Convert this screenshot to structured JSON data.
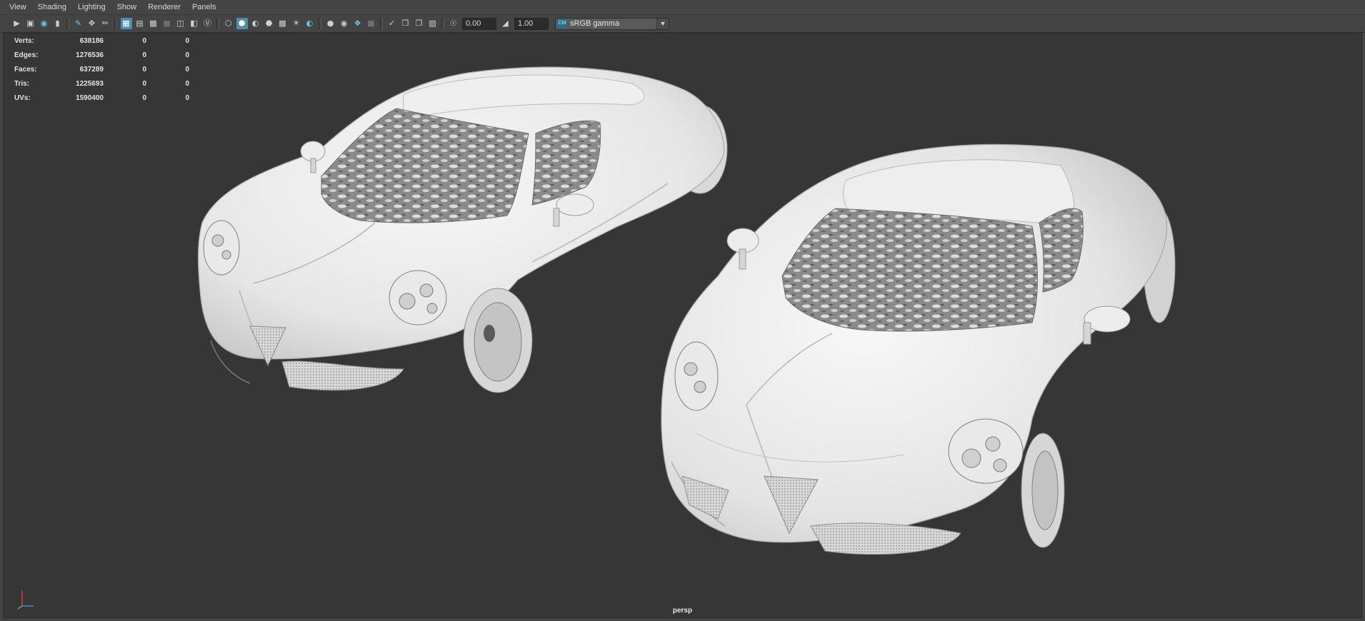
{
  "menu": {
    "items": [
      "View",
      "Shading",
      "Lighting",
      "Show",
      "Renderer",
      "Panels"
    ]
  },
  "toolbar": {
    "exposure_value": "0.00",
    "gamma_value": "1.00",
    "color_space": "sRGB gamma",
    "color_space_icon": "csm-icon",
    "accent_color": "#4a8fb0"
  },
  "hud": {
    "rows": [
      {
        "label": "Verts:",
        "value": "638186",
        "a": "0",
        "b": "0"
      },
      {
        "label": "Edges:",
        "value": "1276536",
        "a": "0",
        "b": "0"
      },
      {
        "label": "Faces:",
        "value": "637289",
        "a": "0",
        "b": "0"
      },
      {
        "label": "Tris:",
        "value": "1225693",
        "a": "0",
        "b": "0"
      },
      {
        "label": "UVs:",
        "value": "1590400",
        "a": "0",
        "b": "0"
      }
    ]
  },
  "viewport": {
    "camera": "persp",
    "background_color": "#363636"
  }
}
